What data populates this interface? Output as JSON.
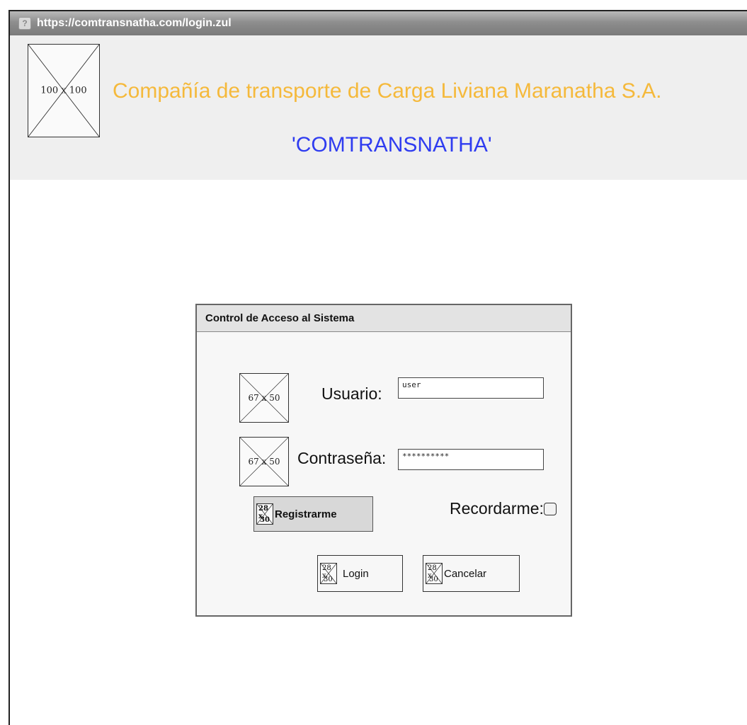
{
  "titlebar": {
    "url": "https://comtransnatha.com/login.zul",
    "help_glyph": "?",
    "close_glyph": "✕"
  },
  "header": {
    "logo_placeholder": "100 x 100",
    "company_name": "Compañía de transporte de Carga Liviana Maranatha S.A.",
    "abbreviation": "'COMTRANSNATHA'"
  },
  "dialog": {
    "title": "Control de Acceso al Sistema",
    "user_icon_placeholder": "67 x 50",
    "pass_icon_placeholder": "67 x 50",
    "username_label": "Usuario:",
    "username_value": "user",
    "password_label": "Contraseña:",
    "password_value": "**********",
    "remember_label": "Recordarme:",
    "remember_checked": false,
    "button_icon_top": "28 x",
    "button_icon_bottom": "30",
    "register_button": "Registrarme",
    "login_button": "Login",
    "cancel_button": "Cancelar"
  },
  "colors": {
    "company_name": "#f5b93b",
    "abbreviation": "#2f3cf0",
    "header_bg": "#efefef",
    "dialog_header_bg": "#e3e3e3"
  }
}
